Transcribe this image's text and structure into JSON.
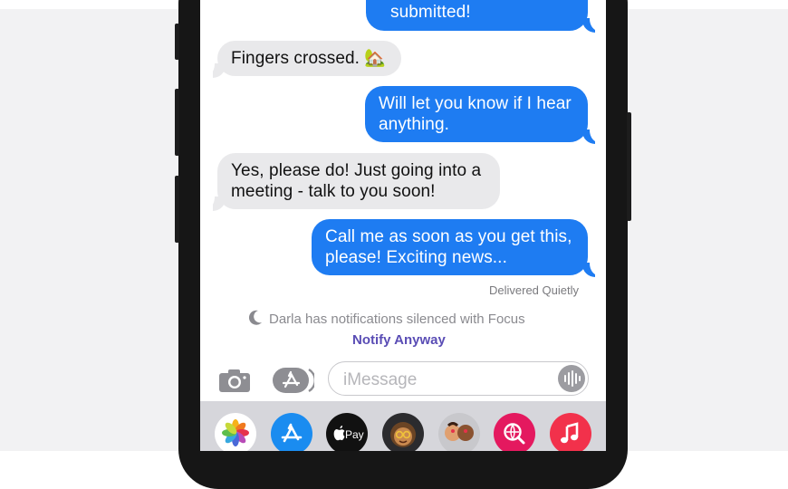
{
  "conversation": {
    "messages": [
      {
        "direction": "outgoing",
        "text": "submitted!"
      },
      {
        "direction": "incoming",
        "text": "Fingers crossed. 🏡"
      },
      {
        "direction": "outgoing",
        "text": "Will let you know if I hear anything."
      },
      {
        "direction": "incoming",
        "text": "Yes, please do! Just going into a meeting - talk to you soon!"
      },
      {
        "direction": "outgoing",
        "text": "Call me as soon as you get this, please! Exciting news..."
      }
    ],
    "delivery_status": "Delivered Quietly",
    "focus_notice": "Darla has notifications silenced with Focus",
    "notify_action": "Notify Anyway"
  },
  "composer": {
    "placeholder": "iMessage",
    "camera_icon": "camera-icon",
    "apps_icon": "app-store-icon",
    "voice_icon": "waveform-icon"
  },
  "app_drawer": {
    "apps": [
      {
        "name": "photos-app-icon"
      },
      {
        "name": "app-store-app-icon"
      },
      {
        "name": "apple-pay-app-icon",
        "label": "Pay"
      },
      {
        "name": "memoji-app-icon"
      },
      {
        "name": "memoji-stickers-app-icon"
      },
      {
        "name": "web-search-app-icon"
      },
      {
        "name": "music-app-icon"
      }
    ]
  },
  "colors": {
    "outgoing_bubble": "#1e7cf2",
    "incoming_bubble": "#e9e9eb",
    "notify_accent": "#5a4db5"
  }
}
